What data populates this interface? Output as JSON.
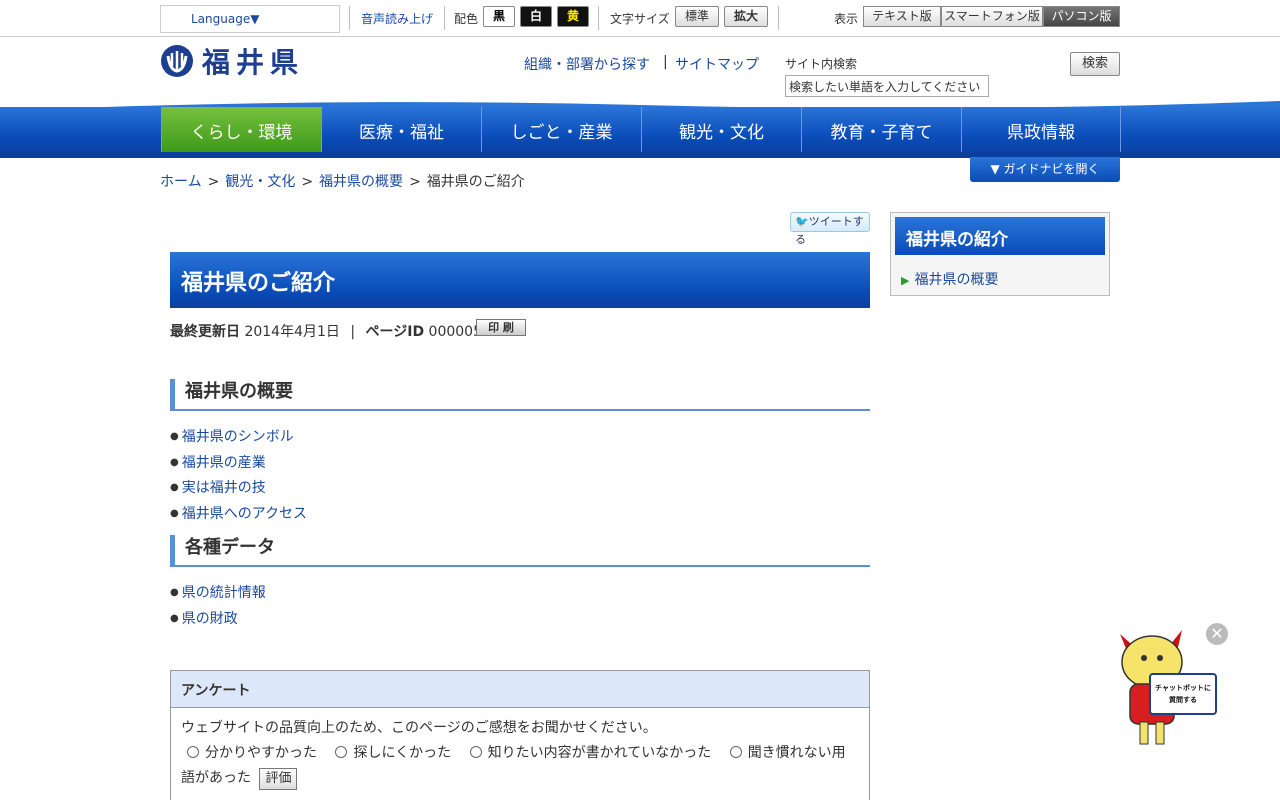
{
  "util": {
    "language": "Language▼",
    "tts": "音声読み上げ",
    "color_label": "配色",
    "colors": [
      {
        "label": "黒",
        "bg": "#ffffff",
        "fg": "#000000"
      },
      {
        "label": "白",
        "bg": "#111111",
        "fg": "#ffffff"
      },
      {
        "label": "黄",
        "bg": "#111111",
        "fg": "#ffe600"
      }
    ],
    "fontsize_label": "文字サイズ",
    "font_standard": "標準",
    "font_large": "拡大",
    "display_label": "表示",
    "display_text": "テキスト版",
    "display_smartphone": "スマートフォン版",
    "display_pc": "パソコン版"
  },
  "header": {
    "logo_text": "福井県",
    "org_search": "組織・部署から探す",
    "separator": "|",
    "sitemap": "サイトマップ",
    "search_label": "サイト内検索",
    "search_placeholder": "検索したい単語を入力してください",
    "search_button": "検索"
  },
  "nav": {
    "items": [
      "くらし・環境",
      "医療・福祉",
      "しごと・産業",
      "観光・文化",
      "教育・子育て",
      "県政情報"
    ],
    "active_index": 0
  },
  "breadcrumb": {
    "home": "ホーム",
    "level1": "観光・文化",
    "level2": "福井県の概要",
    "current": "福井県のご紹介",
    "sep": ">"
  },
  "guide_button": "▼ ガイドナビを開く",
  "tweet": "ツイートする",
  "page": {
    "title": "福井県のご紹介",
    "updated_label": "最終更新日",
    "updated_date": "2014年4月1日",
    "meta_sep": "|",
    "page_id_label": "ページID",
    "page_id": "000005",
    "print": "印 刷"
  },
  "sections": [
    {
      "heading": "福井県の概要",
      "links": [
        "福井県のシンボル",
        "福井県の産業",
        "実は福井の技",
        "福井県へのアクセス"
      ]
    },
    {
      "heading": "各種データ",
      "links": [
        "県の統計情報",
        "県の財政"
      ]
    }
  ],
  "sidebar": {
    "title": "福井県の紹介",
    "link": "福井県の概要"
  },
  "survey": {
    "heading": "アンケート",
    "intro": "ウェブサイトの品質向上のため、このページのご感想をお聞かせください。",
    "options": [
      "分かりやすかった",
      "探しにくかった",
      "知りたい内容が書かれていなかった",
      "聞き慣れない用語があった"
    ],
    "button": "評価"
  },
  "chatbot": {
    "label_line1": "チャットボットに",
    "label_line2": "質問する",
    "close": "✕"
  }
}
